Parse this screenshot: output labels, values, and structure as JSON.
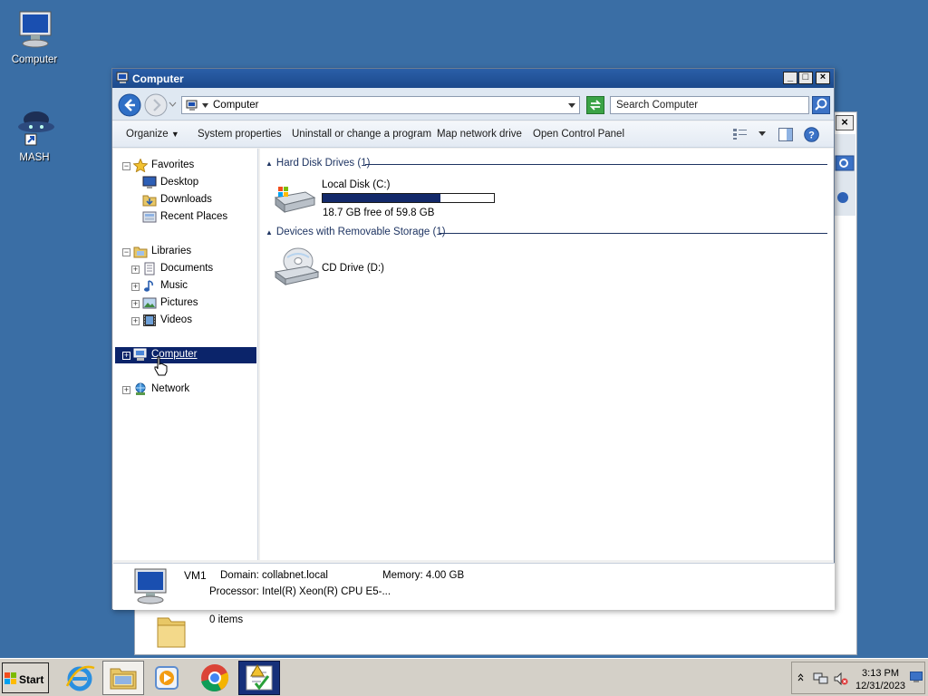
{
  "desktop": {
    "icons": [
      {
        "label": "Computer"
      },
      {
        "label": "MASH"
      }
    ]
  },
  "background_window": {
    "status": "0 items"
  },
  "window": {
    "title": "Computer",
    "address": "Computer",
    "search_placeholder": "Search Computer",
    "commands": {
      "organize": "Organize",
      "system_properties": "System properties",
      "uninstall": "Uninstall or change a program",
      "map_drive": "Map network drive",
      "control_panel": "Open Control Panel"
    },
    "nav": {
      "favorites": "Favorites",
      "desktop": "Desktop",
      "downloads": "Downloads",
      "recent": "Recent Places",
      "libraries": "Libraries",
      "documents": "Documents",
      "music": "Music",
      "pictures": "Pictures",
      "videos": "Videos",
      "computer": "Computer",
      "network": "Network"
    },
    "groups": {
      "hdd": "Hard Disk Drives (1)",
      "removable": "Devices with Removable Storage (1)"
    },
    "drives": {
      "c_name": "Local Disk (C:)",
      "c_free": "18.7 GB free of 59.8 GB",
      "c_used_fraction": 0.687,
      "d_name": "CD Drive (D:)"
    },
    "details": {
      "name": "VM1",
      "domain": "Domain: collabnet.local",
      "memory": "Memory: 4.00 GB",
      "processor": "Processor: Intel(R) Xeon(R) CPU E5-..."
    }
  },
  "taskbar": {
    "start": "Start",
    "time": "3:13 PM",
    "date": "12/31/2023"
  },
  "colors": {
    "desktop": "#3a6ea5",
    "titlebar": "#1c4a8c",
    "selection": "#0b246a",
    "disk_fill": "#13296a"
  }
}
